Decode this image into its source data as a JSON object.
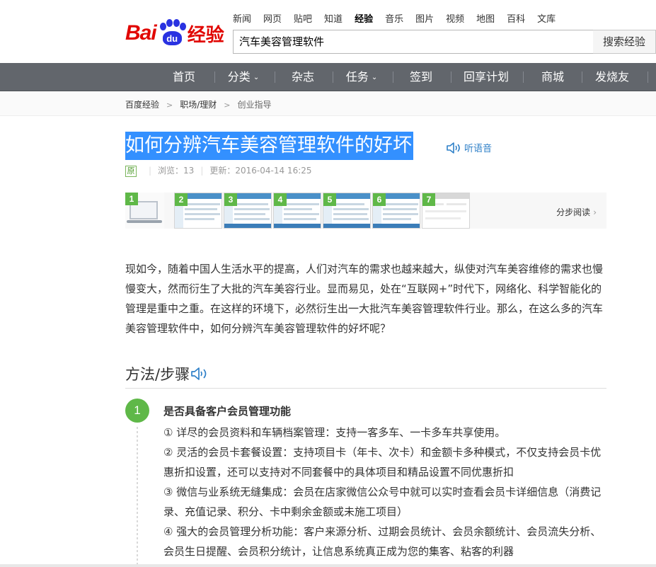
{
  "logo": {
    "left_text": "Bai",
    "paw_text": "du",
    "right_text": "经验"
  },
  "topnav": [
    "新闻",
    "网页",
    "贴吧",
    "知道",
    "经验",
    "音乐",
    "图片",
    "视频",
    "地图",
    "百科",
    "文库"
  ],
  "topnav_active": "经验",
  "search": {
    "value": "汽车美容管理软件",
    "button": "搜索经验"
  },
  "mainnav": [
    "首页",
    "分类",
    "杂志",
    "任务",
    "签到",
    "回享计划",
    "商城",
    "发烧友"
  ],
  "breadcrumb": [
    "百度经验",
    "职场/理财",
    "创业指导"
  ],
  "article": {
    "title": "如何分辨汽车美容管理软件的好坏",
    "listen": "听语音",
    "badge": "原",
    "views": "浏览：13",
    "updated": "更新：2016-04-14 16:25",
    "step_read": "分步阅读",
    "thumb_numbers": [
      "1",
      "2",
      "3",
      "4",
      "5",
      "6",
      "7"
    ],
    "intro": "现如今，随着中国人生活水平的提高，人们对汽车的需求也越来越大，纵使对汽车美容维修的需求也慢慢变大，然而衍生了大批的汽车美容行业。显而易见，处在“互联网+”时代下，网络化、科学智能化的管理是重中之重。在这样的环境下，必然衍生出一大批汽车美容管理软件行业。那么，在这么多的汽车美容管理软件中，如何分辨汽车美容管理软件的好坏呢？",
    "method_heading": "方法/步骤",
    "steps": [
      {
        "number": "1",
        "title": "是否具备客户会员管理功能",
        "lines": [
          "① 详尽的会员资料和车辆档案管理：支持一客多车、一卡多车共享使用。",
          "② 灵活的会员卡套餐设置：支持项目卡（年卡、次卡）和金额卡多种模式，不仅支持会员卡优惠折扣设置，还可以支持对不同套餐中的具体项目和精品设置不同优惠折扣",
          "③ 微信与业系统无缝集成：会员在店家微信公众号中就可以实时查看会员卡详细信息（消费记录、充值记录、积分、卡中剩余金额或未施工项目）",
          "④ 强大的会员管理分析功能：客户来源分析、过期会员统计、会员余额统计、会员流失分析、会员生日提醒、会员积分统计，让信息系统真正成为您的集客、粘客的利器"
        ]
      }
    ]
  },
  "colors": {
    "brand_red": "#e10602",
    "brand_blue": "#2932e1",
    "nav_bg": "#62666c",
    "step_green": "#5fb848",
    "selection": "#3390ff"
  }
}
